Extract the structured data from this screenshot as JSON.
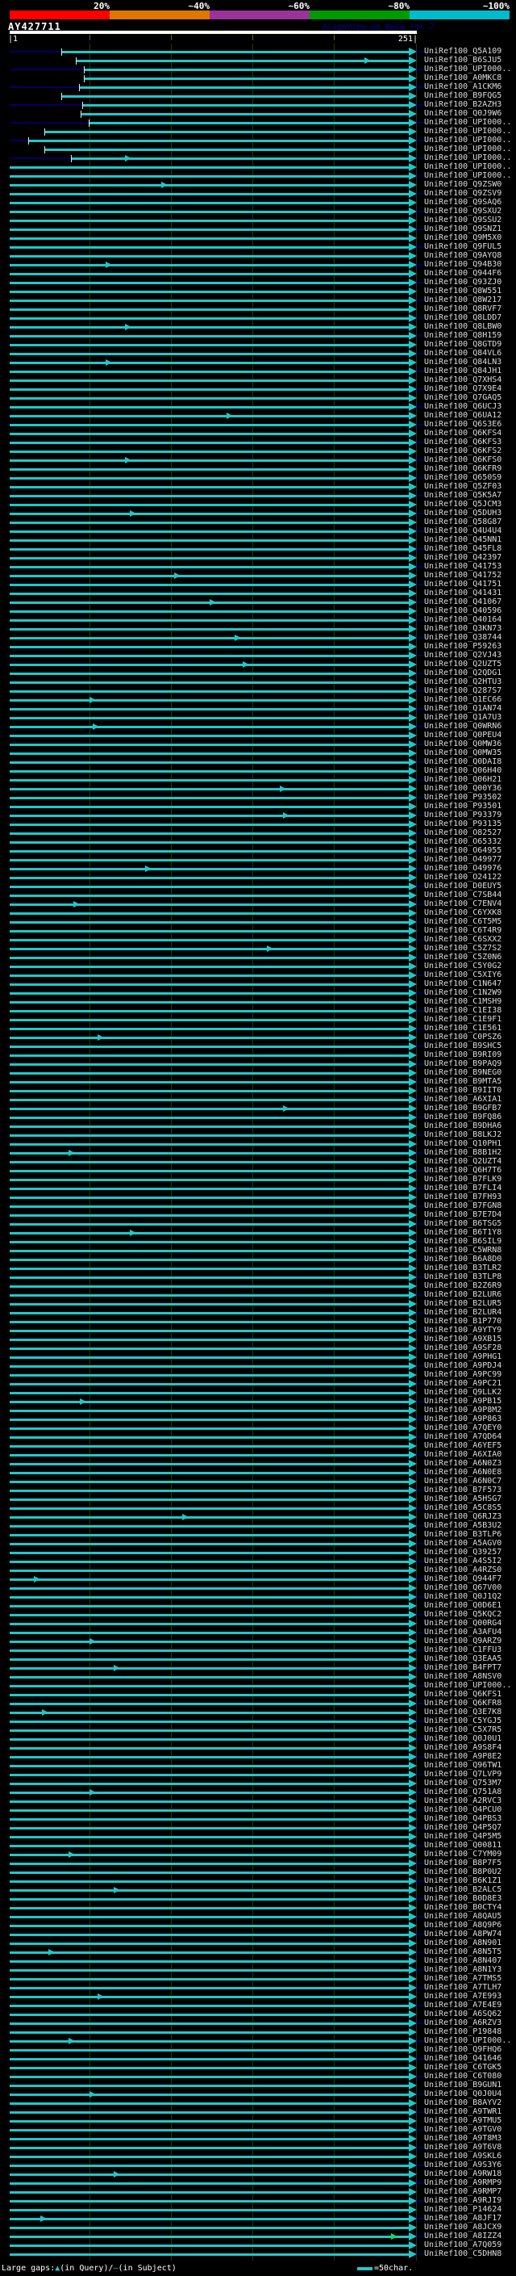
{
  "header": {
    "query_id": "AY427711",
    "watermark": "AlignView.pm Beta rel.7",
    "scale": {
      "labels": [
        "20%",
        "~40%",
        "~60%",
        "~80%",
        "~100%"
      ],
      "colors": [
        "#ff0000",
        "#dd7700",
        "#993399",
        "#009900",
        "#00bbcc"
      ]
    },
    "ruler": {
      "start_label": "|1",
      "end_label": "251|"
    }
  },
  "legend": {
    "gaps_prefix": "Large gaps:",
    "query_gap_symbol": "▲",
    "query_gap_text": "(in Query)/",
    "subject_gap_symbol": "—",
    "subject_gap_text": "(in Subject)",
    "scale_swatch_label": "=50char."
  },
  "colors": {
    "background": "#000000",
    "hit_line": "#1fc8c8",
    "query_line": "#000060",
    "gridline": "#333300",
    "label_text": "#dcdcdc",
    "green_arrow": "#00e060",
    "query_bar": "#fffff2",
    "watermark": "#000099"
  },
  "chart_data": {
    "type": "table",
    "subtype": "blast-alignment-coverage-graphic",
    "title": "AY427711",
    "query_length": 251,
    "axis": {
      "start": 1,
      "end": 251,
      "gridline_interval_residues": 50
    },
    "identity_scale": {
      "labels": [
        "20%",
        "~40%",
        "~60%",
        "~80%",
        "~100%"
      ],
      "colors": [
        "#ff0000",
        "#dd7700",
        "#993399",
        "#009900",
        "#00bbcc"
      ]
    },
    "rows": [
      {
        "label": "UniRef100_Q5A109",
        "start": 33
      },
      {
        "label": "UniRef100_B6SJU5",
        "start": 42,
        "arrows": [
          219
        ]
      },
      {
        "label": "UniRef100_UPI000..",
        "start": 47
      },
      {
        "label": "UniRef100_A0MKC8",
        "start": 47
      },
      {
        "label": "UniRef100_A1CKM6",
        "start": 44
      },
      {
        "label": "UniRef100_B9FQG5",
        "start": 33
      },
      {
        "label": "UniRef100_B2AZH3",
        "start": 46
      },
      {
        "label": "UniRef100_Q0J9W6",
        "start": 45
      },
      {
        "label": "UniRef100_UPI000..",
        "start": 50
      },
      {
        "label": "UniRef100_UPI000..",
        "start": 23
      },
      {
        "label": "UniRef100_UPI000..",
        "start": 13
      },
      {
        "label": "UniRef100_UPI000..",
        "start": 23
      },
      {
        "label": "UniRef100_UPI000..",
        "start": 39,
        "arrows": [
          72
        ]
      },
      {
        "label": "UniRef100_UPI000.."
      },
      {
        "label": "UniRef100_UPI000.."
      },
      {
        "label": "UniRef100_Q9ZSW0",
        "arrows": [
          94
        ]
      },
      {
        "label": "UniRef100_Q9ZSV9"
      },
      {
        "label": "UniRef100_Q9SAQ6"
      },
      {
        "label": "UniRef100_Q9SXU2"
      },
      {
        "label": "UniRef100_Q9SSU2"
      },
      {
        "label": "UniRef100_Q9SNZ1"
      },
      {
        "label": "UniRef100_Q9M5X0"
      },
      {
        "label": "UniRef100_Q9FUL5"
      },
      {
        "label": "UniRef100_Q9AYQ8"
      },
      {
        "label": "UniRef100_Q94B30",
        "arrows": [
          60
        ]
      },
      {
        "label": "UniRef100_Q944F6"
      },
      {
        "label": "UniRef100_Q93ZJ0"
      },
      {
        "label": "UniRef100_Q8W551"
      },
      {
        "label": "UniRef100_Q8W217"
      },
      {
        "label": "UniRef100_Q8RVF7"
      },
      {
        "label": "UniRef100_Q8LDD7"
      },
      {
        "label": "UniRef100_Q8LBW0",
        "arrows": [
          72
        ]
      },
      {
        "label": "UniRef100_Q8H159"
      },
      {
        "label": "UniRef100_Q8GTD9"
      },
      {
        "label": "UniRef100_Q84VL6"
      },
      {
        "label": "UniRef100_Q84LN3",
        "arrows": [
          60
        ]
      },
      {
        "label": "UniRef100_Q84JH1"
      },
      {
        "label": "UniRef100_Q7XHS4"
      },
      {
        "label": "UniRef100_Q7X9E4"
      },
      {
        "label": "UniRef100_Q7GAQ5"
      },
      {
        "label": "UniRef100_Q6UCJ3"
      },
      {
        "label": "UniRef100_Q6UA12",
        "arrows": [
          134
        ]
      },
      {
        "label": "UniRef100_Q6S3E6"
      },
      {
        "label": "UniRef100_Q6KFS4"
      },
      {
        "label": "UniRef100_Q6KFS3"
      },
      {
        "label": "UniRef100_Q6KFS2"
      },
      {
        "label": "UniRef100_Q6KFS0",
        "arrows": [
          72
        ]
      },
      {
        "label": "UniRef100_Q6KFR9"
      },
      {
        "label": "UniRef100_Q650S9"
      },
      {
        "label": "UniRef100_Q5ZF03"
      },
      {
        "label": "UniRef100_Q5K5A7"
      },
      {
        "label": "UniRef100_Q5JCM3"
      },
      {
        "label": "UniRef100_Q5DUH3",
        "arrows": [
          75
        ]
      },
      {
        "label": "UniRef100_Q58G87"
      },
      {
        "label": "UniRef100_Q4U4U4"
      },
      {
        "label": "UniRef100_Q45NN1"
      },
      {
        "label": "UniRef100_Q45FL8"
      },
      {
        "label": "UniRef100_Q42397"
      },
      {
        "label": "UniRef100_Q41753"
      },
      {
        "label": "UniRef100_Q41752",
        "arrows": [
          102
        ]
      },
      {
        "label": "UniRef100_Q41751"
      },
      {
        "label": "UniRef100_Q41431"
      },
      {
        "label": "UniRef100_Q41067",
        "arrows": [
          124
        ]
      },
      {
        "label": "UniRef100_Q40596"
      },
      {
        "label": "UniRef100_Q40164"
      },
      {
        "label": "UniRef100_Q3KN73"
      },
      {
        "label": "UniRef100_Q38744",
        "arrows": [
          139
        ]
      },
      {
        "label": "UniRef100_P59263"
      },
      {
        "label": "UniRef100_Q2VJ43"
      },
      {
        "label": "UniRef100_Q2UZT5",
        "arrows": [
          144
        ]
      },
      {
        "label": "UniRef100_Q2QDG1"
      },
      {
        "label": "UniRef100_Q2HTU3"
      },
      {
        "label": "UniRef100_Q287S7"
      },
      {
        "label": "UniRef100_Q1EC66",
        "arrows": [
          50
        ]
      },
      {
        "label": "UniRef100_Q1AN74"
      },
      {
        "label": "UniRef100_Q1A7U3"
      },
      {
        "label": "UniRef100_Q0WRN6",
        "arrows": [
          52
        ]
      },
      {
        "label": "UniRef100_Q0PEU4"
      },
      {
        "label": "UniRef100_Q0MW36"
      },
      {
        "label": "UniRef100_Q0MW35"
      },
      {
        "label": "UniRef100_Q0DAI8"
      },
      {
        "label": "UniRef100_Q06H40"
      },
      {
        "label": "UniRef100_Q06H21"
      },
      {
        "label": "UniRef100_Q00Y36",
        "arrows": [
          167
        ]
      },
      {
        "label": "UniRef100_P93502"
      },
      {
        "label": "UniRef100_P93501"
      },
      {
        "label": "UniRef100_P93379",
        "arrows": [
          169
        ]
      },
      {
        "label": "UniRef100_P93135"
      },
      {
        "label": "UniRef100_O82527"
      },
      {
        "label": "UniRef100_O65332"
      },
      {
        "label": "UniRef100_O64955"
      },
      {
        "label": "UniRef100_O49977"
      },
      {
        "label": "UniRef100_O49976",
        "arrows": [
          84
        ]
      },
      {
        "label": "UniRef100_O24122"
      },
      {
        "label": "UniRef100_D0EUY5"
      },
      {
        "label": "UniRef100_C7SB44"
      },
      {
        "label": "UniRef100_C7ENV4",
        "arrows": [
          40
        ]
      },
      {
        "label": "UniRef100_C6YXK8"
      },
      {
        "label": "UniRef100_C6T5M5"
      },
      {
        "label": "UniRef100_C6T4R9"
      },
      {
        "label": "UniRef100_C6SXX2"
      },
      {
        "label": "UniRef100_C5Z7S2",
        "arrows": [
          159
        ]
      },
      {
        "label": "UniRef100_C5Z0N6"
      },
      {
        "label": "UniRef100_C5Y0G2"
      },
      {
        "label": "UniRef100_C5XIY6"
      },
      {
        "label": "UniRef100_C1N647"
      },
      {
        "label": "UniRef100_C1N2W9"
      },
      {
        "label": "UniRef100_C1MSH9"
      },
      {
        "label": "UniRef100_C1EI38"
      },
      {
        "label": "UniRef100_C1E9F1"
      },
      {
        "label": "UniRef100_C1E561"
      },
      {
        "label": "UniRef100_C0PSZ6",
        "arrows": [
          55
        ]
      },
      {
        "label": "UniRef100_B9SHC5"
      },
      {
        "label": "UniRef100_B9RI09"
      },
      {
        "label": "UniRef100_B9PAQ9"
      },
      {
        "label": "UniRef100_B9NEG0"
      },
      {
        "label": "UniRef100_B9MTA5"
      },
      {
        "label": "UniRef100_B9IIT0"
      },
      {
        "label": "UniRef100_A6XIA1"
      },
      {
        "label": "UniRef100_B9GFB7",
        "arrows": [
          169
        ]
      },
      {
        "label": "UniRef100_B9FQ86"
      },
      {
        "label": "UniRef100_B9DHA6"
      },
      {
        "label": "UniRef100_B8LKJ2"
      },
      {
        "label": "UniRef100_Q10PH1"
      },
      {
        "label": "UniRef100_B8B1H2",
        "arrows": [
          37
        ]
      },
      {
        "label": "UniRef100_Q2UZT4"
      },
      {
        "label": "UniRef100_Q6H7T6"
      },
      {
        "label": "UniRef100_B7FLK9"
      },
      {
        "label": "UniRef100_B7FLI4"
      },
      {
        "label": "UniRef100_B7FH93"
      },
      {
        "label": "UniRef100_B7FGN8"
      },
      {
        "label": "UniRef100_B7E7D4"
      },
      {
        "label": "UniRef100_B6TSG5"
      },
      {
        "label": "UniRef100_B6T1Y8",
        "arrows": [
          75
        ]
      },
      {
        "label": "UniRef100_B6SIL9"
      },
      {
        "label": "UniRef100_C5WRN8"
      },
      {
        "label": "UniRef100_B6A8D0"
      },
      {
        "label": "UniRef100_B3TLR2"
      },
      {
        "label": "UniRef100_B3TLP8"
      },
      {
        "label": "UniRef100_B2Z6R9"
      },
      {
        "label": "UniRef100_B2LUR6"
      },
      {
        "label": "UniRef100_B2LUR5"
      },
      {
        "label": "UniRef100_B2LUR4"
      },
      {
        "label": "UniRef100_B1P770"
      },
      {
        "label": "UniRef100_A9YTY9"
      },
      {
        "label": "UniRef100_A9XB15"
      },
      {
        "label": "UniRef100_A9SF28"
      },
      {
        "label": "UniRef100_A9PHG1"
      },
      {
        "label": "UniRef100_A9PDJ4"
      },
      {
        "label": "UniRef100_A9PC99"
      },
      {
        "label": "UniRef100_A9PC21"
      },
      {
        "label": "UniRef100_Q9LLK2"
      },
      {
        "label": "UniRef100_A9PB15",
        "arrows": [
          44
        ]
      },
      {
        "label": "UniRef100_A9P8M2"
      },
      {
        "label": "UniRef100_A9P863"
      },
      {
        "label": "UniRef100_A7QEY0"
      },
      {
        "label": "UniRef100_A7QD64"
      },
      {
        "label": "UniRef100_A6YEF5"
      },
      {
        "label": "UniRef100_A6XIA0"
      },
      {
        "label": "UniRef100_A6N0Z3"
      },
      {
        "label": "UniRef100_A6N0E8"
      },
      {
        "label": "UniRef100_A6N0C7"
      },
      {
        "label": "UniRef100_B7F573"
      },
      {
        "label": "UniRef100_A5HSG7"
      },
      {
        "label": "UniRef100_A5C8S5"
      },
      {
        "label": "UniRef100_Q6RJZ3",
        "arrows": [
          107
        ]
      },
      {
        "label": "UniRef100_A5B3U2"
      },
      {
        "label": "UniRef100_B3TLP6"
      },
      {
        "label": "UniRef100_A5AGV0"
      },
      {
        "label": "UniRef100_Q39257"
      },
      {
        "label": "UniRef100_A4S5I2"
      },
      {
        "label": "UniRef100_A4RZS0"
      },
      {
        "label": "UniRef100_Q944F7",
        "arrows": [
          16
        ]
      },
      {
        "label": "UniRef100_Q67V00"
      },
      {
        "label": "UniRef100_Q0J1Q2"
      },
      {
        "label": "UniRef100_Q0D6E1"
      },
      {
        "label": "UniRef100_Q5KQC2"
      },
      {
        "label": "UniRef100_Q00RG4"
      },
      {
        "label": "UniRef100_A3AFU4"
      },
      {
        "label": "UniRef100_Q9ARZ9",
        "arrows": [
          50
        ]
      },
      {
        "label": "UniRef100_C1FFU3"
      },
      {
        "label": "UniRef100_Q3EAA5"
      },
      {
        "label": "UniRef100_B4FPT7",
        "arrows": [
          65
        ]
      },
      {
        "label": "UniRef100_A8NSV0"
      },
      {
        "label": "UniRef100_UPI000.."
      },
      {
        "label": "UniRef100_Q6KFS1"
      },
      {
        "label": "UniRef100_Q6KFR8"
      },
      {
        "label": "UniRef100_Q3E7K8",
        "arrows": [
          21
        ]
      },
      {
        "label": "UniRef100_C5YGJ5"
      },
      {
        "label": "UniRef100_C5X7R5"
      },
      {
        "label": "UniRef100_Q0J0U1"
      },
      {
        "label": "UniRef100_A9S8F4"
      },
      {
        "label": "UniRef100_A9P8E2"
      },
      {
        "label": "UniRef100_Q96TW1"
      },
      {
        "label": "UniRef100_Q7LVP9"
      },
      {
        "label": "UniRef100_Q753M7"
      },
      {
        "label": "UniRef100_Q751A8",
        "arrows": [
          50
        ]
      },
      {
        "label": "UniRef100_A2RVC3"
      },
      {
        "label": "UniRef100_Q4PCU0"
      },
      {
        "label": "UniRef100_Q4PBS3"
      },
      {
        "label": "UniRef100_Q4P5Q7"
      },
      {
        "label": "UniRef100_Q4P5M5"
      },
      {
        "label": "UniRef100_Q00811"
      },
      {
        "label": "UniRef100_C7YM09",
        "arrows": [
          37
        ]
      },
      {
        "label": "UniRef100_B8P7F5"
      },
      {
        "label": "UniRef100_B8P0U2"
      },
      {
        "label": "UniRef100_B6K1Z1"
      },
      {
        "label": "UniRef100_B2ALC5",
        "arrows": [
          65
        ]
      },
      {
        "label": "UniRef100_B0D8E3"
      },
      {
        "label": "UniRef100_B0CTY4"
      },
      {
        "label": "UniRef100_A8QAU5"
      },
      {
        "label": "UniRef100_A8Q9P6"
      },
      {
        "label": "UniRef100_A8PW74"
      },
      {
        "label": "UniRef100_A8N901"
      },
      {
        "label": "UniRef100_A8N5T5",
        "arrows": [
          25
        ]
      },
      {
        "label": "UniRef100_A8N407"
      },
      {
        "label": "UniRef100_A8N1Y3"
      },
      {
        "label": "UniRef100_A7TMS5"
      },
      {
        "label": "UniRef100_A7TLH7"
      },
      {
        "label": "UniRef100_A7E993",
        "arrows": [
          55
        ]
      },
      {
        "label": "UniRef100_A7E4E9"
      },
      {
        "label": "UniRef100_A6SQ62"
      },
      {
        "label": "UniRef100_A6RZV3"
      },
      {
        "label": "UniRef100_P19848"
      },
      {
        "label": "UniRef100_UPI000..",
        "arrows": [
          37
        ]
      },
      {
        "label": "UniRef100_Q9FHQ6"
      },
      {
        "label": "UniRef100_Q41646"
      },
      {
        "label": "UniRef100_C6TGK5"
      },
      {
        "label": "UniRef100_C6T080"
      },
      {
        "label": "UniRef100_B9GUN1"
      },
      {
        "label": "UniRef100_Q0J0U4",
        "arrows": [
          50
        ]
      },
      {
        "label": "UniRef100_B8AYV2"
      },
      {
        "label": "UniRef100_A9TWR1"
      },
      {
        "label": "UniRef100_A9TMU5"
      },
      {
        "label": "UniRef100_A9TGV0"
      },
      {
        "label": "UniRef100_A9T8M3"
      },
      {
        "label": "UniRef100_A9T6V8"
      },
      {
        "label": "UniRef100_A9SKL6"
      },
      {
        "label": "UniRef100_A9S3Y6"
      },
      {
        "label": "UniRef100_A9RW18",
        "arrows": [
          65
        ]
      },
      {
        "label": "UniRef100_A9RMP9"
      },
      {
        "label": "UniRef100_A9RMP7"
      },
      {
        "label": "UniRef100_A9RJI9"
      },
      {
        "label": "UniRef100_P14624"
      },
      {
        "label": "UniRef100_A8JF17",
        "arrows": [
          20
        ]
      },
      {
        "label": "UniRef100_A8JCX9"
      },
      {
        "label": "UniRef100_A8IZZ4",
        "arrows": [
          235
        ],
        "arrow_color": "green"
      },
      {
        "label": "UniRef100_A7Q059"
      },
      {
        "label": "UniRef100_C5DHN8"
      }
    ]
  }
}
